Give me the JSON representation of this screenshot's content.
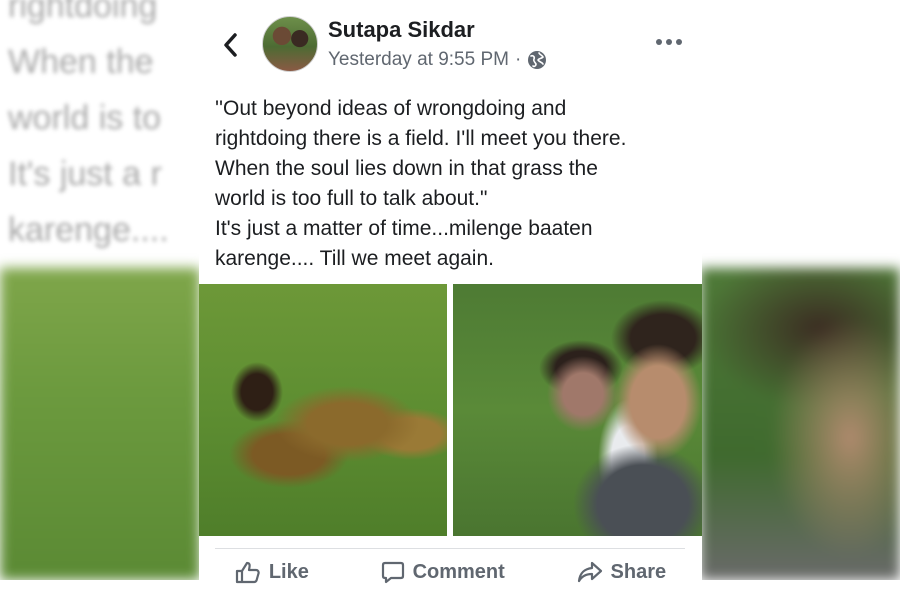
{
  "backdrop": {
    "text_lines": [
      "rightdoing                                     u there.",
      "When the                                       s the",
      "world is to",
      "It's just a r                                 aaten",
      "karenge...."
    ]
  },
  "post": {
    "author": "Sutapa Sikdar",
    "timestamp": "Yesterday at 9:55 PM",
    "separator": "·",
    "privacy_icon": "globe-icon",
    "text_lines": [
      "''Out beyond ideas of wrongdoing and",
      "rightdoing there is a field. I'll meet you there.",
      "When the soul lies down in that grass the",
      "world is too full to talk about.\"",
      "It's just a matter of time...milenge baaten",
      "karenge.... Till we meet again."
    ]
  },
  "actions": {
    "like": "Like",
    "comment": "Comment",
    "share": "Share"
  },
  "colors": {
    "text_primary": "#1c1e21",
    "text_secondary": "#606770",
    "divider": "#dddfe2"
  }
}
